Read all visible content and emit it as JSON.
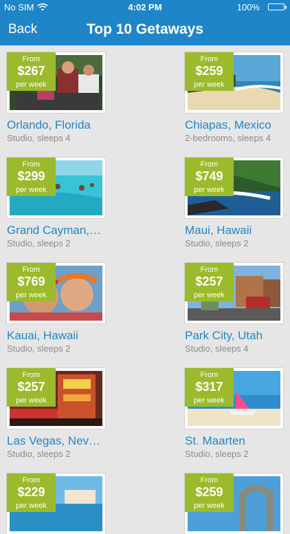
{
  "status": {
    "carrier": "No SIM",
    "time": "4:02 PM",
    "battery": "100%"
  },
  "nav": {
    "back_label": "Back",
    "title": "Top 10 Getaways"
  },
  "price_labels": {
    "from": "From",
    "per_week": "per week"
  },
  "getaways": [
    {
      "name": "Orlando, Florida",
      "details": "Studio, sleeps 4",
      "price": "$267"
    },
    {
      "name": "Chiapas, Mexico",
      "details": "2-bedrooms, sleeps 4",
      "price": "$259"
    },
    {
      "name": "Grand Cayman,…",
      "details": "Studio, sleeps 2",
      "price": "$299"
    },
    {
      "name": "Maui, Hawaii",
      "details": "Studio, sleeps 2",
      "price": "$749"
    },
    {
      "name": "Kauai, Hawaii",
      "details": "Studio, sleeps 2",
      "price": "$769"
    },
    {
      "name": "Park City, Utah",
      "details": "Studio, sleeps 4",
      "price": "$257"
    },
    {
      "name": "Las Vegas, Nev…",
      "details": "Studio, sleeps 2",
      "price": "$257"
    },
    {
      "name": "St. Maarten",
      "details": "Studio, sleeps 2",
      "price": "$317"
    },
    {
      "name": "",
      "details": "",
      "price": "$229"
    },
    {
      "name": "",
      "details": "",
      "price": "$259"
    }
  ],
  "colors": {
    "header": "#1f85c9",
    "badge": "#9bba2c",
    "title_text": "#1f86c6",
    "sub_text": "#8c8c8c",
    "background": "#e6e6e6"
  }
}
